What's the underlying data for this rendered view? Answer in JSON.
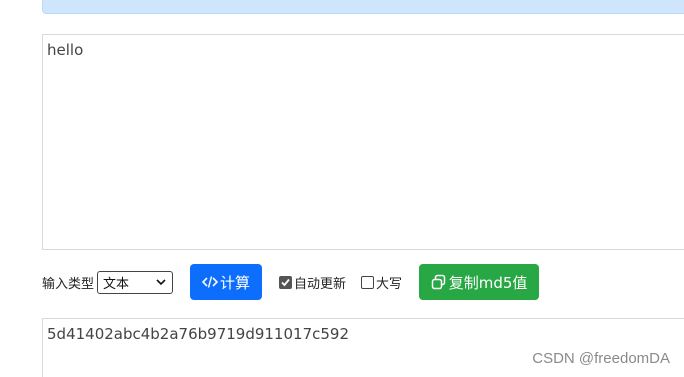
{
  "input": {
    "value": "hello"
  },
  "controls": {
    "type_label": "输入类型",
    "type_select_value": "文本",
    "calc_label": "计算",
    "auto_update_label": "自动更新",
    "auto_update_checked": true,
    "uppercase_label": "大写",
    "uppercase_checked": false,
    "copy_label": "复制md5值"
  },
  "output": {
    "value": "5d41402abc4b2a76b9719d911017c592"
  },
  "watermark": "CSDN @freedomDA",
  "colors": {
    "calc_button": "#0d6efd",
    "copy_button": "#28a745",
    "info_bar": "#cfe5fb"
  },
  "icons": {
    "calc": "code-icon",
    "copy": "copy-icon",
    "select": "chevron-down-icon"
  }
}
